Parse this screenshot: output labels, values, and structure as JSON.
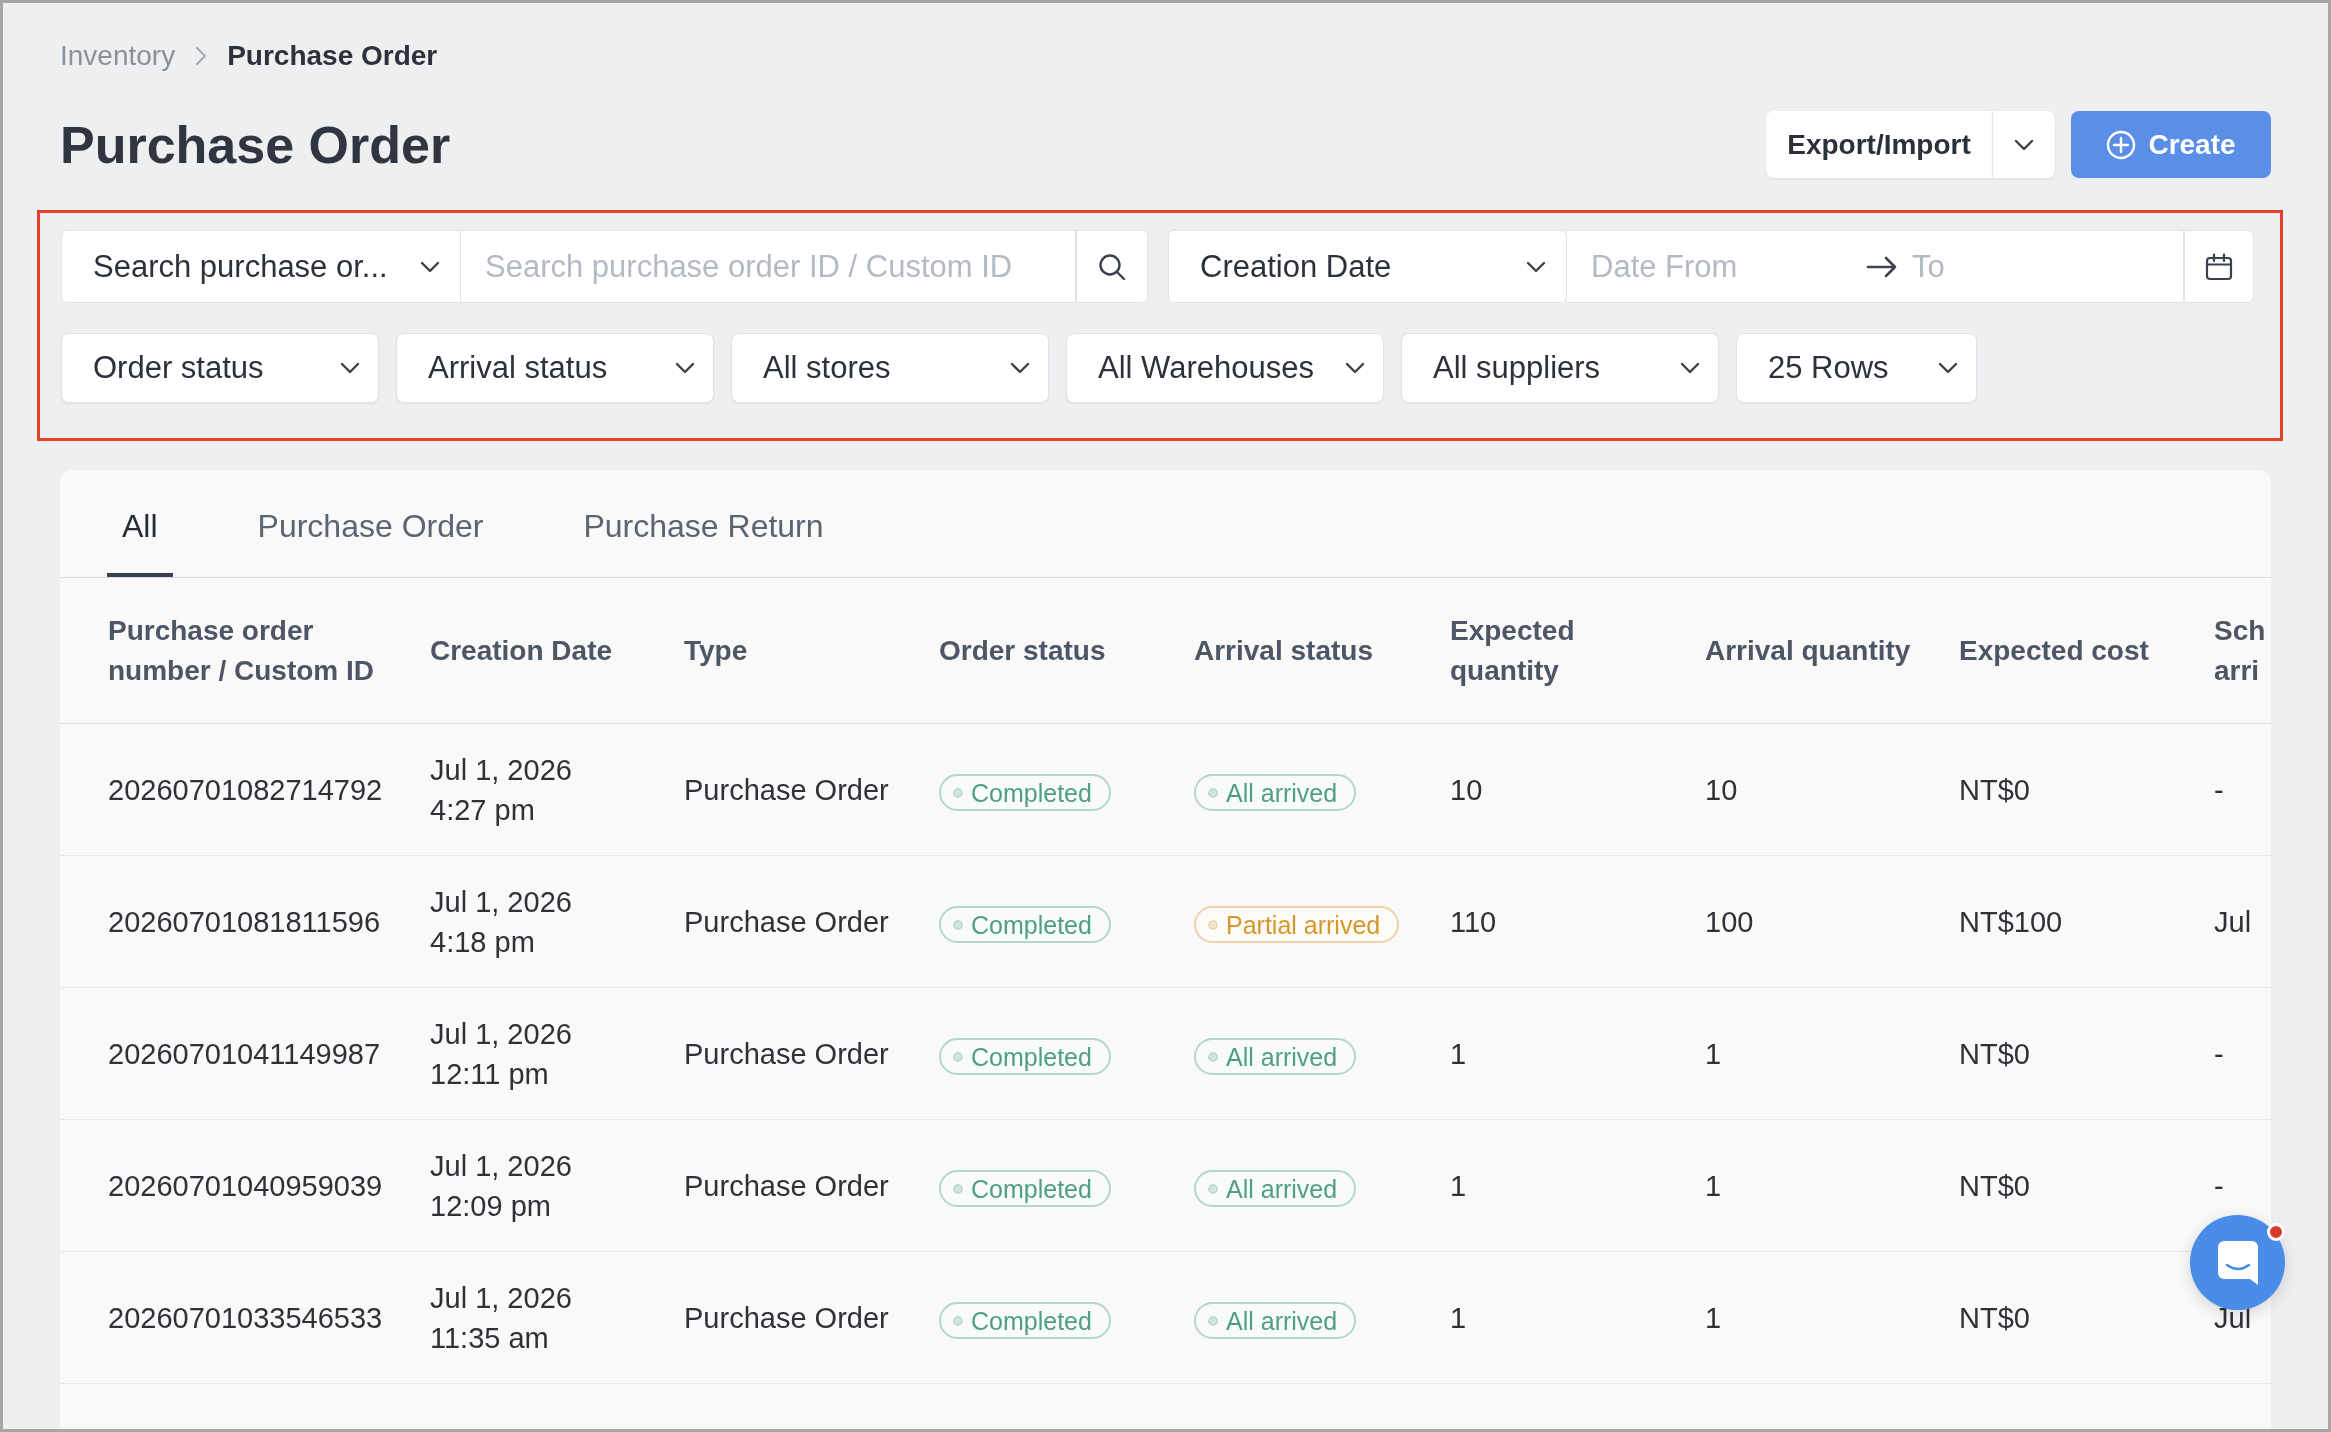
{
  "breadcrumb": [
    {
      "label": "Inventory",
      "current": false
    },
    {
      "label": "Purchase Order",
      "current": true
    }
  ],
  "page_title": "Purchase Order",
  "actions": {
    "export_import": "Export/Import",
    "create": "Create"
  },
  "filters": {
    "highlighted": true,
    "search_scope": "Search purchase or...",
    "search": {
      "placeholder": "Search purchase order ID / Custom ID"
    },
    "date_type": "Creation Date",
    "date_from": {
      "placeholder": "Date From"
    },
    "date_to": {
      "placeholder": "To"
    },
    "dropdowns": [
      "Order status",
      "Arrival status",
      "All stores",
      "All Warehouses",
      "All suppliers",
      "25 Rows"
    ]
  },
  "tabs": [
    {
      "label": "All",
      "selected": true
    },
    {
      "label": "Purchase Order",
      "selected": false
    },
    {
      "label": "Purchase Return",
      "selected": false
    }
  ],
  "table": {
    "columns": [
      "Purchase order number / Custom ID",
      "Creation Date",
      "Type",
      "Order status",
      "Arrival status",
      "Expected quantity",
      "Arrival quantity",
      "Expected cost",
      "Sch arri"
    ],
    "rows": [
      {
        "order_number": "20260701082714792",
        "date": "Jul 1, 2026",
        "time": "4:27 pm",
        "type": "Purchase Order",
        "order_status": {
          "label": "Completed",
          "color": "#4f9f80"
        },
        "arrival_status": {
          "label": "All arrived",
          "color": "#4f9f80"
        },
        "expected_quantity": "10",
        "arrival_quantity": "10",
        "expected_cost": "NT$0",
        "column_9": "-"
      },
      {
        "order_number": "20260701081811596",
        "date": "Jul 1, 2026",
        "time": "4:18 pm",
        "type": "Purchase Order",
        "order_status": {
          "label": "Completed",
          "color": "#4f9f80"
        },
        "arrival_status": {
          "label": "Partial arrived",
          "color": "#d4972c"
        },
        "expected_quantity": "110",
        "arrival_quantity": "100",
        "expected_cost": "NT$100",
        "column_9": "Jul"
      },
      {
        "order_number": "20260701041149987",
        "date": "Jul 1, 2026",
        "time": "12:11 pm",
        "type": "Purchase Order",
        "order_status": {
          "label": "Completed",
          "color": "#4f9f80"
        },
        "arrival_status": {
          "label": "All arrived",
          "color": "#4f9f80"
        },
        "expected_quantity": "1",
        "arrival_quantity": "1",
        "expected_cost": "NT$0",
        "column_9": "-"
      },
      {
        "order_number": "20260701040959039",
        "date": "Jul 1, 2026",
        "time": "12:09 pm",
        "type": "Purchase Order",
        "order_status": {
          "label": "Completed",
          "color": "#4f9f80"
        },
        "arrival_status": {
          "label": "All arrived",
          "color": "#4f9f80"
        },
        "expected_quantity": "1",
        "arrival_quantity": "1",
        "expected_cost": "NT$0",
        "column_9": "-"
      },
      {
        "order_number": "20260701033546533",
        "date": "Jul 1, 2026",
        "time": "11:35 am",
        "type": "Purchase Order",
        "order_status": {
          "label": "Completed",
          "color": "#4f9f80"
        },
        "arrival_status": {
          "label": "All arrived",
          "color": "#4f9f80"
        },
        "expected_quantity": "1",
        "arrival_quantity": "1",
        "expected_cost": "NT$0",
        "column_9": "Jul"
      }
    ]
  },
  "chat_button": {
    "has_notification": true
  }
}
